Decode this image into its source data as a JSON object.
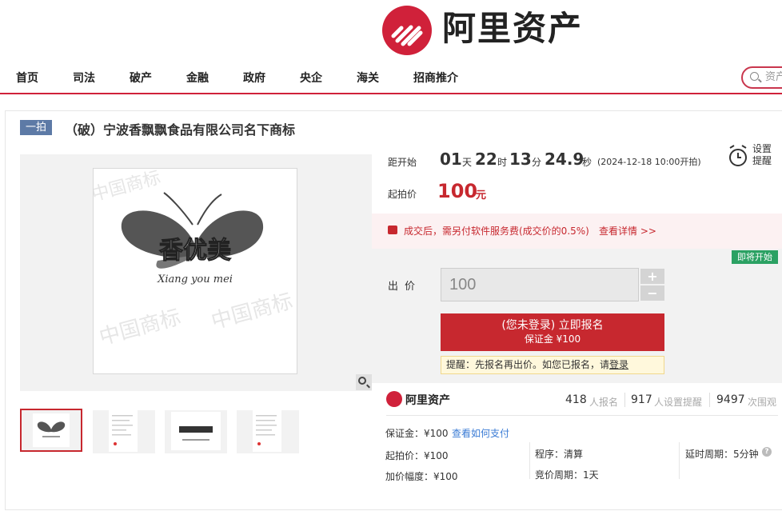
{
  "brand": {
    "name": "阿里资产",
    "accent": "#d0213a"
  },
  "nav": {
    "items": [
      "首页",
      "司法",
      "破产",
      "金融",
      "政府",
      "央企",
      "海关",
      "招商推介"
    ],
    "search_placeholder": "资产"
  },
  "listing": {
    "tag": "一拍",
    "title": "（破）宁波香飘飘食品有限公司名下商标"
  },
  "image": {
    "logo_text": "香优美",
    "logo_caption": "Xiang you mei",
    "watermark": "中国商标",
    "thumbnail_count": 4
  },
  "countdown": {
    "label": "距开始",
    "days": "01",
    "days_unit": "天",
    "hours": "22",
    "hours_unit": "时",
    "minutes": "13",
    "minutes_unit": "分",
    "seconds": "24.9",
    "seconds_unit": "秒",
    "start_time": "(2024-12-18 10:00开拍)"
  },
  "reminder": {
    "line1": "设置",
    "line2": "提醒"
  },
  "start_price": {
    "label": "起拍价",
    "value": "100",
    "unit": "元"
  },
  "fee": {
    "text": "成交后，需另付软件服务费(成交价的0.5%)",
    "link": "查看详情 >>"
  },
  "bid": {
    "status_badge": "即将开始",
    "label": "出价",
    "value": "100",
    "plus": "+",
    "minus": "−",
    "register_line1": "(您未登录) 立即报名",
    "register_line2": "保证金 ¥100",
    "remind_prefix": "提醒：先报名再出价。如您已报名，请",
    "remind_link": "登录"
  },
  "stats": {
    "brand": "阿里资产",
    "signups": "418",
    "signups_label": "人报名",
    "reminders": "917",
    "reminders_label": "人设置提醒",
    "views": "9497",
    "views_label": "次围观"
  },
  "details": {
    "deposit": "保证金：¥100",
    "deposit_link": "查看如何支付",
    "start_price": "起拍价：¥100",
    "increment": "加价幅度：¥100",
    "procedure": "程序：清算",
    "period": "竞价周期：1天",
    "delay": "延时周期：5分钟"
  }
}
